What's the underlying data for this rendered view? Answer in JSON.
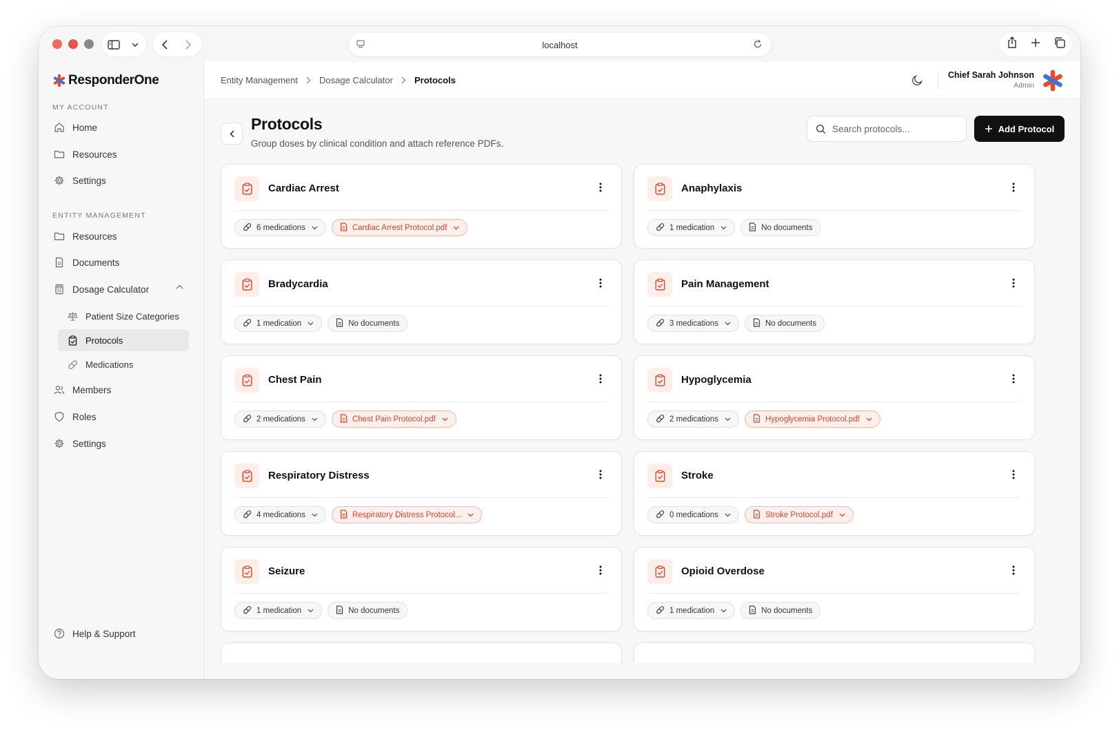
{
  "browser": {
    "url": "localhost",
    "traffic_lights": [
      "#ed6a5e",
      "#e5564a",
      "#8a8a8a"
    ]
  },
  "brand": {
    "name": "ResponderOne",
    "accent": "#e8492b",
    "accent2": "#3a74d8"
  },
  "sidebar": {
    "my_account_label": "MY ACCOUNT",
    "my_account": [
      {
        "label": "Home",
        "icon": "home-icon"
      },
      {
        "label": "Resources",
        "icon": "folder-icon"
      },
      {
        "label": "Settings",
        "icon": "gear-icon"
      }
    ],
    "entity_label": "ENTITY MANAGEMENT",
    "entity": [
      {
        "label": "Resources",
        "icon": "folder-icon"
      },
      {
        "label": "Documents",
        "icon": "document-icon"
      },
      {
        "label": "Dosage Calculator",
        "icon": "calculator-icon"
      }
    ],
    "dosage_sub": [
      {
        "label": "Patient Size Categories",
        "icon": "scale-icon"
      },
      {
        "label": "Protocols",
        "icon": "clipboard-icon"
      },
      {
        "label": "Medications",
        "icon": "pill-icon"
      }
    ],
    "entity_more": [
      {
        "label": "Members",
        "icon": "users-icon"
      },
      {
        "label": "Roles",
        "icon": "shield-icon"
      },
      {
        "label": "Settings",
        "icon": "gear-icon"
      }
    ],
    "help": "Help & Support"
  },
  "breadcrumb": [
    "Entity Management",
    "Dosage Calculator",
    "Protocols"
  ],
  "user": {
    "name": "Chief Sarah Johnson",
    "role": "Admin"
  },
  "page": {
    "title": "Protocols",
    "subtitle": "Group doses by clinical condition and attach reference PDFs.",
    "search_placeholder": "Search protocols...",
    "add_label": "Add Protocol"
  },
  "protocols": [
    {
      "title": "Cardiac Arrest",
      "meds": "6 medications",
      "doc": "Cardiac Arrest Protocol.pdf",
      "has_doc": true
    },
    {
      "title": "Anaphylaxis",
      "meds": "1 medication",
      "doc": "No documents",
      "has_doc": false
    },
    {
      "title": "Bradycardia",
      "meds": "1 medication",
      "doc": "No documents",
      "has_doc": false
    },
    {
      "title": "Pain Management",
      "meds": "3 medications",
      "doc": "No documents",
      "has_doc": false
    },
    {
      "title": "Chest Pain",
      "meds": "2 medications",
      "doc": "Chest Pain Protocol.pdf",
      "has_doc": true
    },
    {
      "title": "Hypoglycemia",
      "meds": "2 medications",
      "doc": "Hypoglycemia Protocol.pdf",
      "has_doc": true
    },
    {
      "title": "Respiratory Distress",
      "meds": "4 medications",
      "doc": "Respiratory Distress Protocol...",
      "has_doc": true
    },
    {
      "title": "Stroke",
      "meds": "0 medications",
      "doc": "Stroke Protocol.pdf",
      "has_doc": true
    },
    {
      "title": "Seizure",
      "meds": "1 medication",
      "doc": "No documents",
      "has_doc": false
    },
    {
      "title": "Opioid Overdose",
      "meds": "1 medication",
      "doc": "No documents",
      "has_doc": false
    }
  ]
}
